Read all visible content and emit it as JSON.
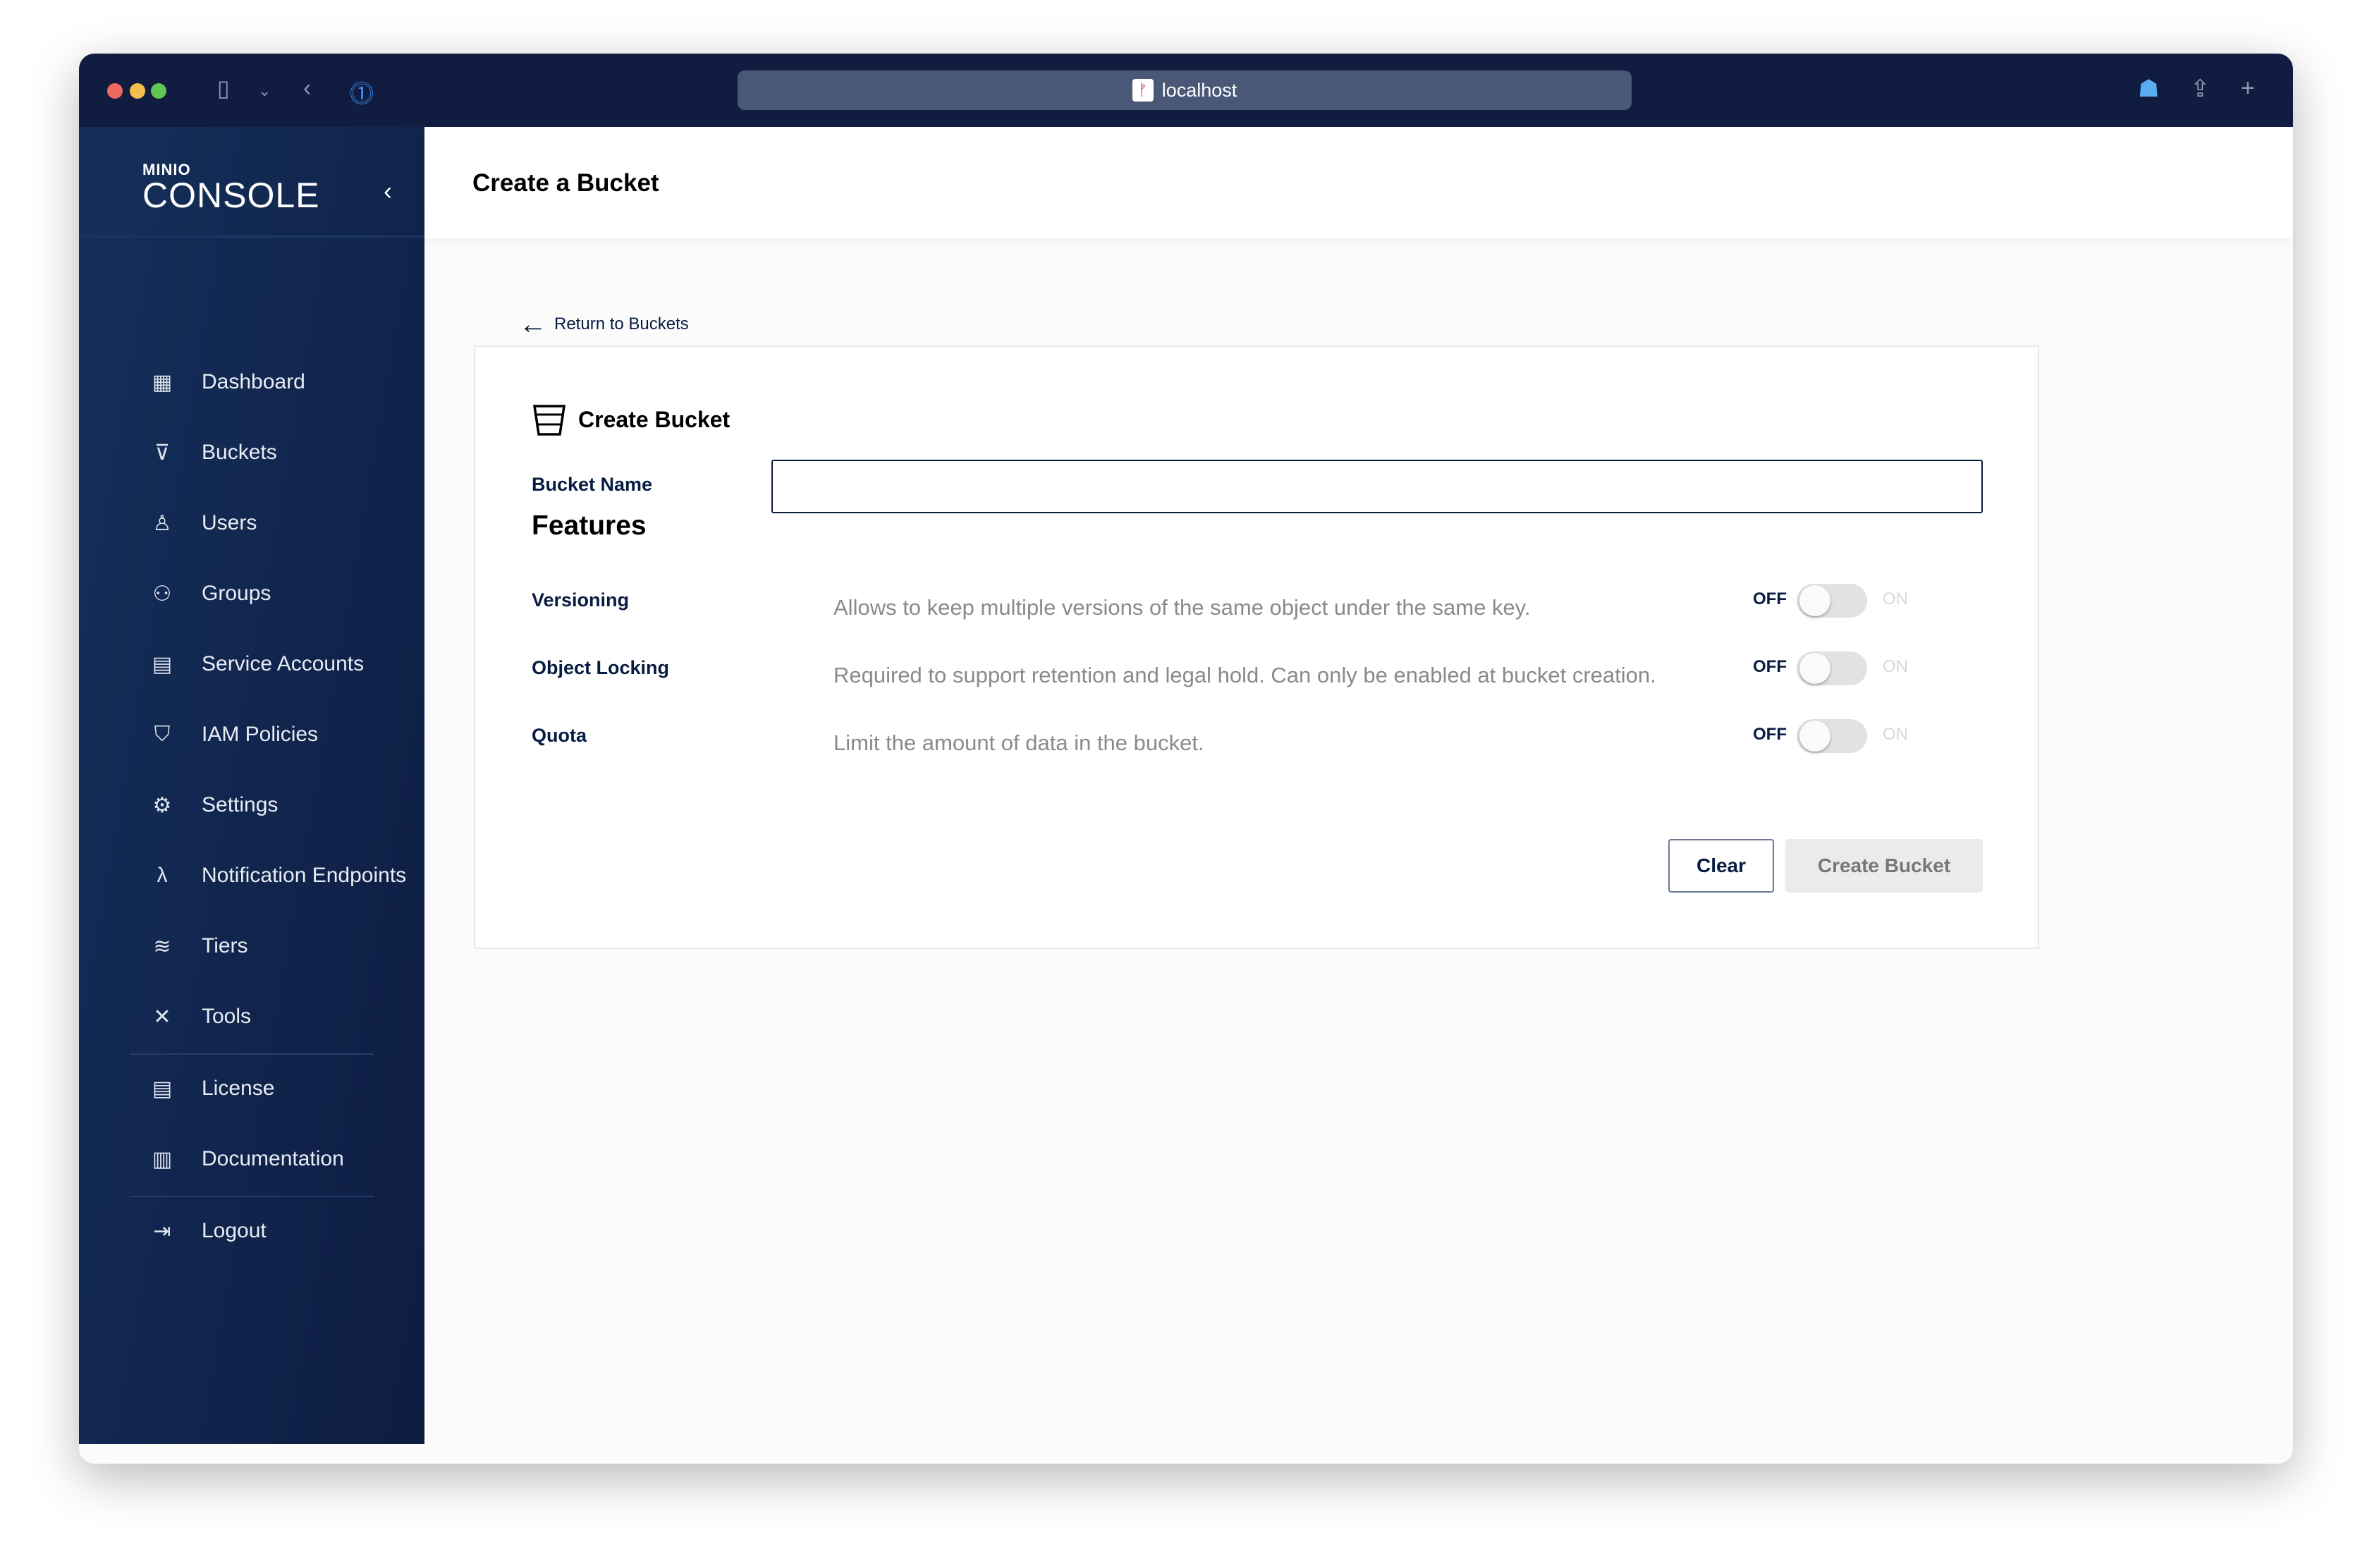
{
  "browser": {
    "url": "localhost",
    "icons": [
      "sidebar-toggle-icon",
      "chevron-down-icon",
      "back-icon",
      "password-manager-icon",
      "ghost-extension-icon",
      "share-icon",
      "new-tab-icon"
    ]
  },
  "sidebar": {
    "logo_top": "MINIO",
    "logo_bottom": "CONSOLE",
    "items": [
      {
        "label": "Dashboard",
        "icon": "dashboard-icon"
      },
      {
        "label": "Buckets",
        "icon": "bucket-icon"
      },
      {
        "label": "Users",
        "icon": "user-icon"
      },
      {
        "label": "Groups",
        "icon": "groups-icon"
      },
      {
        "label": "Service Accounts",
        "icon": "service-accounts-icon"
      },
      {
        "label": "IAM Policies",
        "icon": "shield-icon"
      },
      {
        "label": "Settings",
        "icon": "gear-icon"
      },
      {
        "label": "Notification Endpoints",
        "icon": "lambda-icon"
      },
      {
        "label": "Tiers",
        "icon": "layers-icon"
      },
      {
        "label": "Tools",
        "icon": "tools-icon"
      },
      {
        "label": "License",
        "icon": "license-icon"
      },
      {
        "label": "Documentation",
        "icon": "documentation-icon"
      },
      {
        "label": "Logout",
        "icon": "logout-icon"
      }
    ]
  },
  "header": {
    "title": "Create a Bucket"
  },
  "main": {
    "back_link": "Return to Buckets",
    "card_title": "Create Bucket",
    "bucket_name_label": "Bucket Name",
    "bucket_name_value": "",
    "features_title": "Features",
    "features": [
      {
        "label": "Versioning",
        "description": "Allows to keep multiple versions of the same object under the same key.",
        "off": "OFF",
        "on": "ON",
        "enabled": false
      },
      {
        "label": "Object Locking",
        "description": "Required to support retention and legal hold. Can only be enabled at bucket creation.",
        "off": "OFF",
        "on": "ON",
        "enabled": false
      },
      {
        "label": "Quota",
        "description": "Limit the amount of data in the bucket.",
        "off": "OFF",
        "on": "ON",
        "enabled": false
      }
    ],
    "clear_label": "Clear",
    "create_label": "Create Bucket"
  },
  "colors": {
    "sidebar": "#0e1c42",
    "titlebar": "#101d40",
    "accent": "#081c42"
  }
}
